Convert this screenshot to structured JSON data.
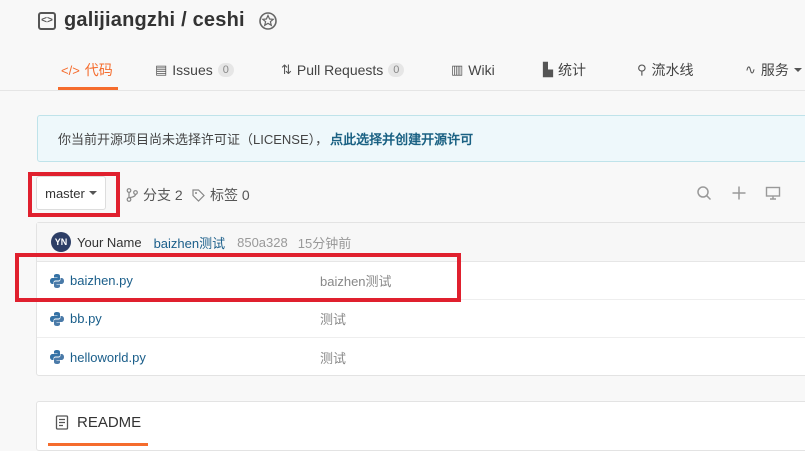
{
  "header": {
    "owner": "galijiangzhi",
    "separator": "/",
    "repo": "ceshi"
  },
  "tabs": [
    {
      "label": "代码",
      "icon": "code-icon",
      "active": true
    },
    {
      "label": "Issues",
      "count": "0",
      "icon": "issues-icon"
    },
    {
      "label": "Pull Requests",
      "count": "0",
      "icon": "pull-request-icon"
    },
    {
      "label": "Wiki",
      "icon": "wiki-icon"
    },
    {
      "label": "统计",
      "icon": "chart-icon"
    },
    {
      "label": "流水线",
      "icon": "pipeline-icon"
    },
    {
      "label": "服务",
      "icon": "pulse-icon"
    }
  ],
  "license": {
    "text": "你当前开源项目尚未选择许可证（LICENSE），",
    "link": "点此选择并创建开源许可"
  },
  "branch": {
    "selected": "master",
    "branches_label": "分支 2",
    "tags_label": "标签 0"
  },
  "commit": {
    "avatar_initials": "YN",
    "author": "Your Name",
    "message": "baizhen测试",
    "hash": "850a328",
    "time": "15分钟前"
  },
  "files": [
    {
      "name": "baizhen.py",
      "message": "baizhen测试"
    },
    {
      "name": "bb.py",
      "message": "测试"
    },
    {
      "name": "helloworld.py",
      "message": "测试"
    }
  ],
  "readme": {
    "label": "README"
  },
  "colors": {
    "accent": "#f56c2d",
    "link": "#1a5e8a",
    "highlight": "#e0202e"
  }
}
